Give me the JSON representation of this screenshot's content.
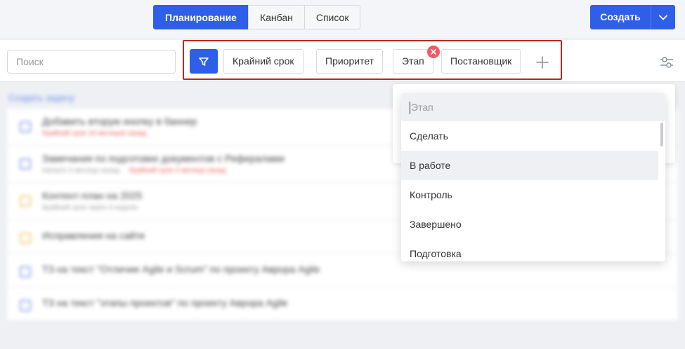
{
  "views": {
    "tabs": [
      {
        "label": "Планирование",
        "active": true
      },
      {
        "label": "Канбан",
        "active": false
      },
      {
        "label": "Список",
        "active": false
      }
    ]
  },
  "header": {
    "create_label": "Создать",
    "create_caret_icon": "chevron-down-icon"
  },
  "search": {
    "placeholder": "Поиск"
  },
  "filters": {
    "funnel_icon": "filter-icon",
    "chips": [
      {
        "label": "Крайний срок"
      },
      {
        "label": "Приоритет"
      },
      {
        "label": "Этап"
      },
      {
        "label": "Постановщик"
      }
    ],
    "add_icon": "plus-icon",
    "settings_icon": "sliders-icon",
    "remove_icon": "close-circle-icon"
  },
  "tasks": {
    "create_link": "Создать задачу",
    "rows": [
      {
        "title": "Добавить вторую кнопку в баннер",
        "meta_red": "Крайний срок 18 месяцев назад",
        "meta_gray": "",
        "color": "blue"
      },
      {
        "title": "Замечания по подготовке документов с Рефералами",
        "meta_red": "Крайний срок 4 месяца назад",
        "meta_gray": "Начало 4 месяца назад",
        "color": "blue"
      },
      {
        "title": "Контент-план на 2025",
        "meta_red": "",
        "meta_gray": "Крайний срок через 3 недели",
        "color": "yellow"
      },
      {
        "title": "Исправления на сайте",
        "meta_red": "",
        "meta_gray": "",
        "color": "yellow"
      },
      {
        "title": "ТЗ на текст \"Отличие Agile и Scrum\" по проекту Аврора Agile",
        "meta_red": "",
        "meta_gray": "",
        "color": "blue"
      },
      {
        "title": "ТЗ на текст \"этапы проектов\" по проекту Аврора Agile",
        "meta_red": "",
        "meta_gray": "",
        "color": "blue"
      }
    ]
  },
  "stage_dropdown": {
    "search_placeholder": "Этап",
    "options": [
      {
        "label": "Сделать"
      },
      {
        "label": "В работе"
      },
      {
        "label": "Контроль"
      },
      {
        "label": "Завершено"
      },
      {
        "label": "Подготовка"
      }
    ]
  },
  "colors": {
    "accent": "#2f5fe8",
    "highlight_outline": "#b82a1e",
    "remove_badge": "#f05a63"
  }
}
